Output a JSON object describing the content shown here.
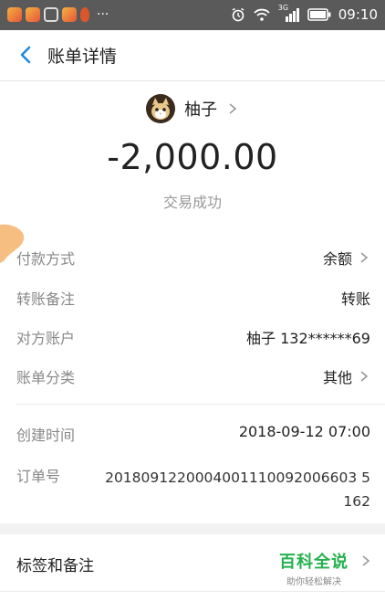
{
  "status_bar": {
    "dots": "···",
    "network": "3G",
    "time": "09:10"
  },
  "header": {
    "title": "账单详情"
  },
  "counterparty": {
    "name": "柚子"
  },
  "transaction": {
    "amount": "-2,000.00",
    "status": "交易成功"
  },
  "details": {
    "payment_method": {
      "label": "付款方式",
      "value": "余额"
    },
    "transfer_note": {
      "label": "转账备注",
      "value": "转账"
    },
    "counter_account": {
      "label": "对方账户",
      "value": "柚子 132******69"
    },
    "category": {
      "label": "账单分类",
      "value": "其他"
    },
    "created_time": {
      "label": "创建时间",
      "value": "2018-09-12 07:00"
    },
    "order_number": {
      "label": "订单号",
      "value": "2018091220004001110092006603 5162"
    }
  },
  "tags": {
    "label": "标签和备注"
  },
  "watermark": {
    "main": "百科全说",
    "sub": "助你轻松解决"
  },
  "colors": {
    "brand_green": "#23b14d",
    "back_blue": "#1e8be0",
    "status_bar": "#5a5a5a"
  }
}
